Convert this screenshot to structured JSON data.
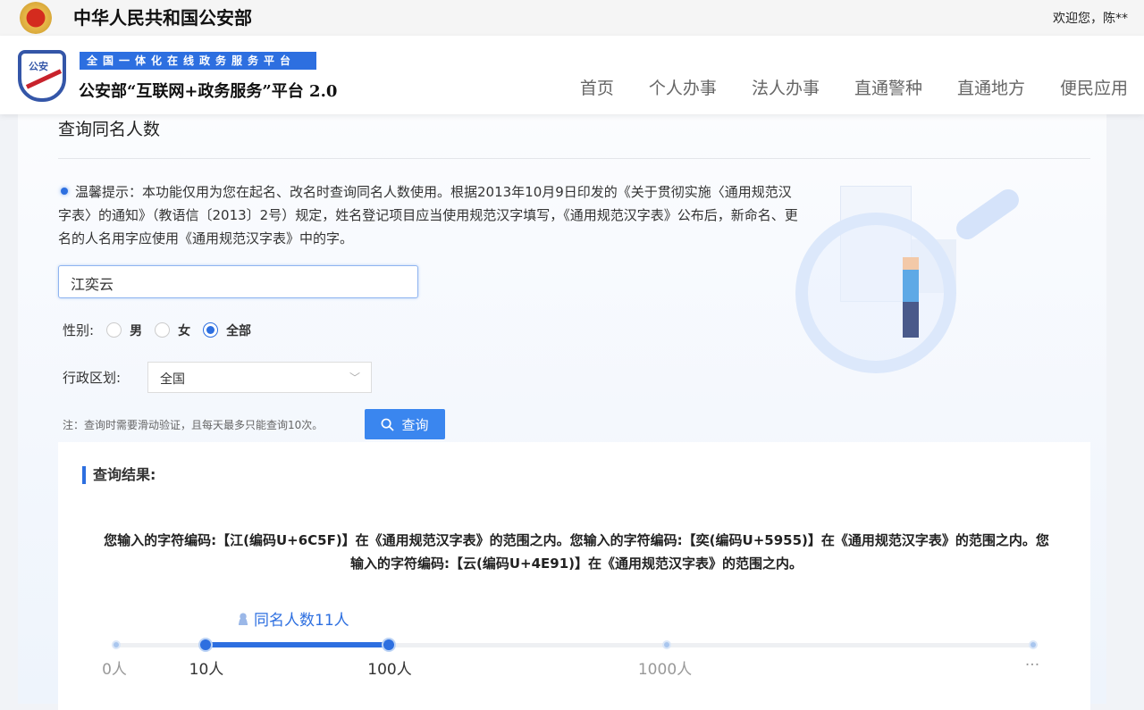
{
  "topbar": {
    "site_name": "中华人民共和国公安部",
    "welcome": "欢迎您，陈**"
  },
  "header": {
    "logo_text": "公安",
    "banner": "全国一体化在线政务服务平台",
    "platform": "公安部“互联网+政务服务”平台 2.0",
    "nav": [
      "首页",
      "个人办事",
      "法人办事",
      "直通警种",
      "直通地方",
      "便民应用"
    ]
  },
  "page": {
    "title": "查询同名人数",
    "tip": "温馨提示：本功能仅用为您在起名、改名时查询同名人数使用。根据2013年10月9日印发的《关于贯彻实施〈通用规范汉字表〉的通知》（教语信〔2013〕2号）规定，姓名登记项目应当使用规范汉字填写，《通用规范汉字表》公布后，新命名、更名的人名用字应使用《通用规范汉字表》中的字。",
    "name_value": "江奕云",
    "gender_label": "性别:",
    "gender_options": [
      "男",
      "女",
      "全部"
    ],
    "gender_selected": "全部",
    "region_label": "行政区划:",
    "region_value": "全国",
    "note": "注：查询时需要滑动验证，且每天最多只能查询10次。",
    "query_button": "查询"
  },
  "results": {
    "title": "查询结果:",
    "text": "您输入的字符编码:【江(编码U+6C5F)】在《通用规范汉字表》的范围之内。您输入的字符编码:【奕(编码U+5955)】在《通用规范汉字表》的范围之内。您输入的字符编码:【云(编码U+4E91)】在《通用规范汉字表》的范围之内。",
    "count_label": "同名人数11人",
    "scale": [
      "0人",
      "10人",
      "100人",
      "1000人",
      "···"
    ],
    "range_from": "10人",
    "range_to": "100人"
  }
}
